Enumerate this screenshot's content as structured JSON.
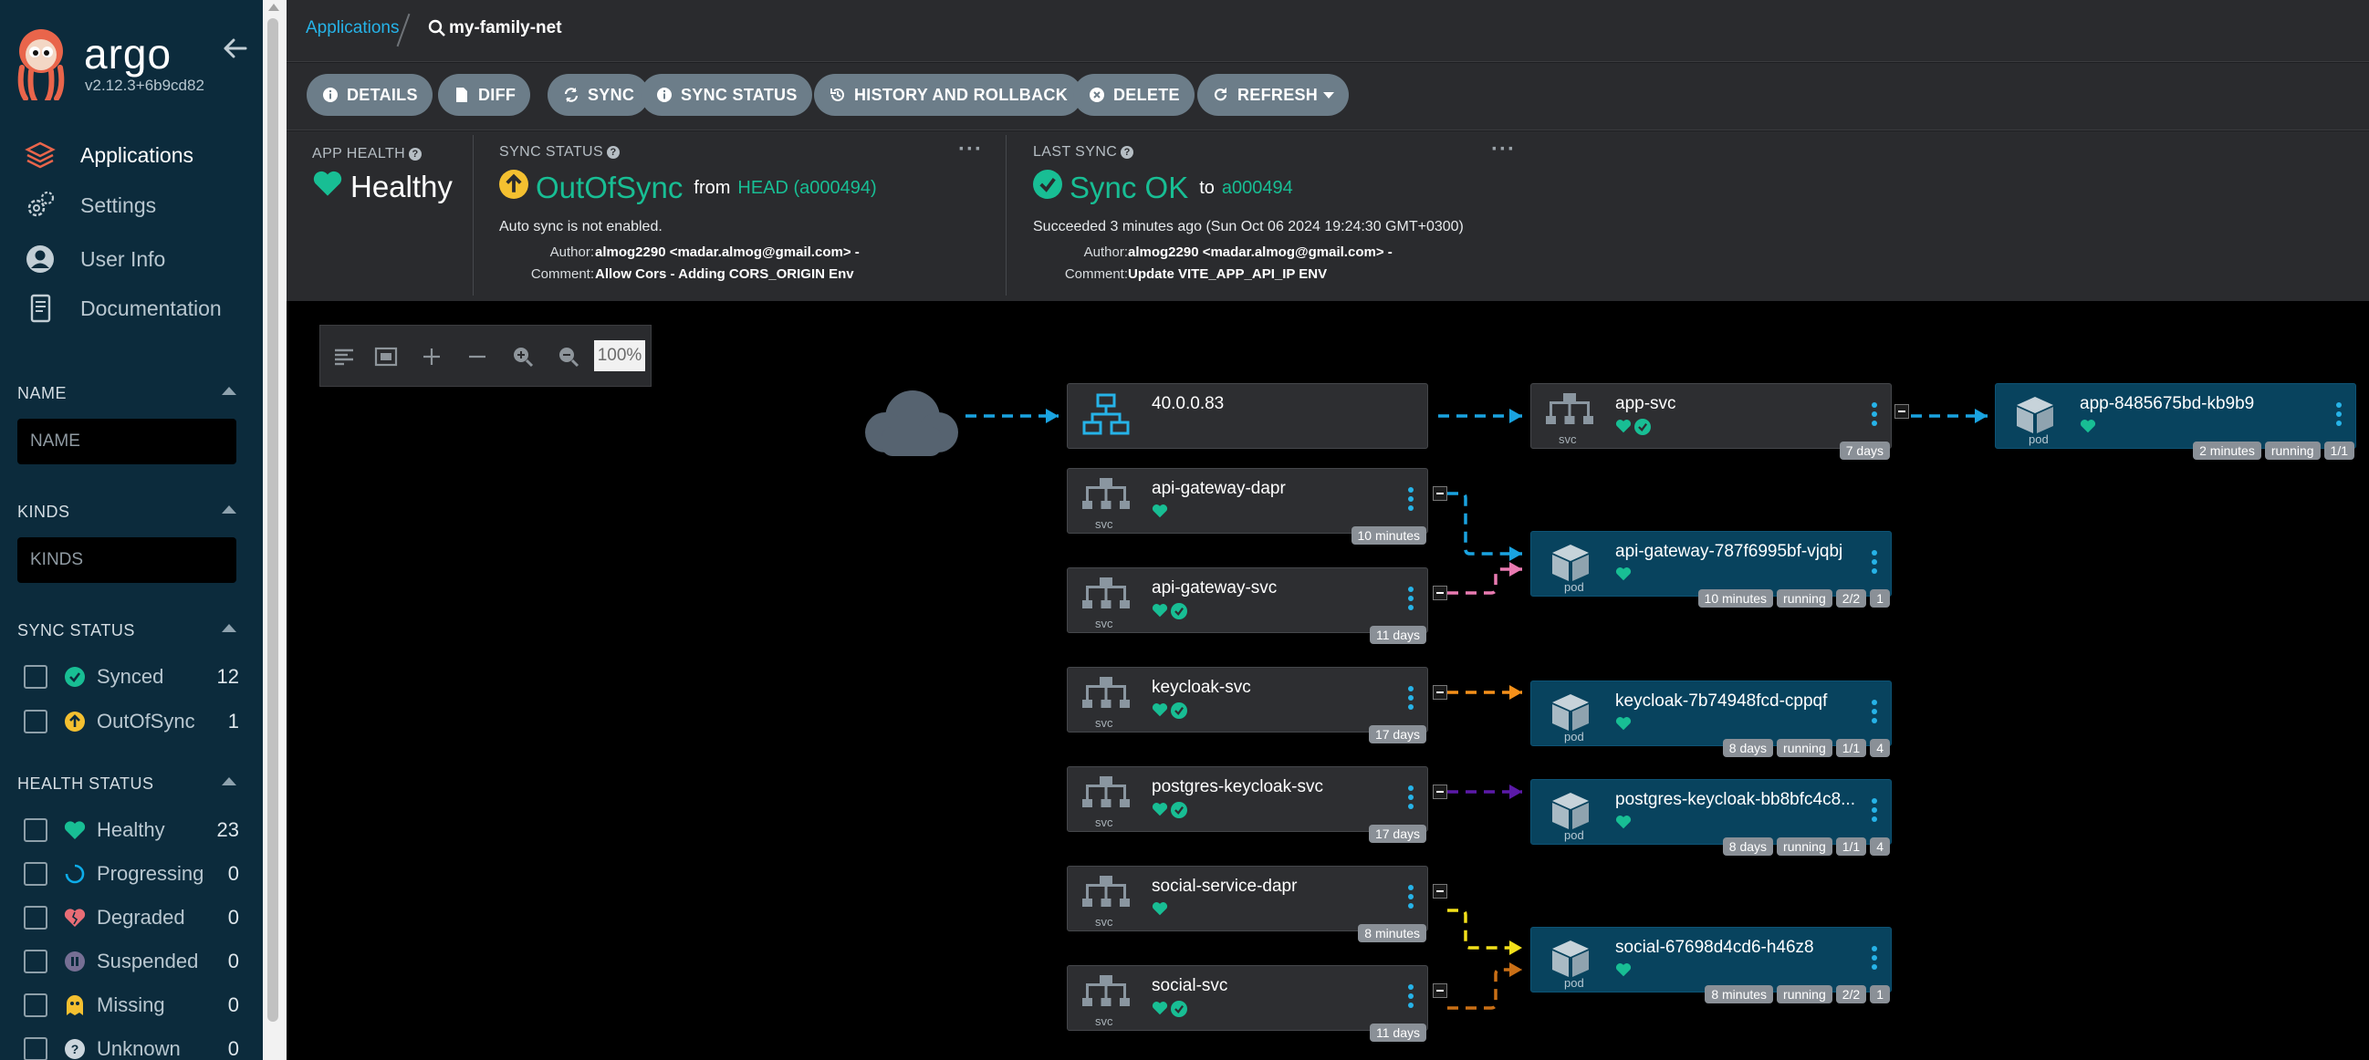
{
  "app": {
    "brand": "argo",
    "version": "v2.12.3+6b9cd82"
  },
  "nav": [
    {
      "label": "Applications",
      "icon": "layers-icon",
      "active": true
    },
    {
      "label": "Settings",
      "icon": "gears-icon",
      "active": false
    },
    {
      "label": "User Info",
      "icon": "user-circle-icon",
      "active": false
    },
    {
      "label": "Documentation",
      "icon": "book-icon",
      "active": false
    }
  ],
  "filters": {
    "name": {
      "label": "NAME",
      "placeholder": "NAME"
    },
    "kinds": {
      "label": "KINDS",
      "placeholder": "KINDS"
    },
    "sync_status": {
      "label": "SYNC STATUS",
      "items": [
        {
          "label": "Synced",
          "count": "12",
          "color": "#18be94"
        },
        {
          "label": "OutOfSync",
          "count": "1",
          "color": "#f4c030"
        }
      ]
    },
    "health_status": {
      "label": "HEALTH STATUS",
      "items": [
        {
          "label": "Healthy",
          "count": "23",
          "color": "#18be94"
        },
        {
          "label": "Progressing",
          "count": "0",
          "color": "#0dadea"
        },
        {
          "label": "Degraded",
          "count": "0",
          "color": "#e96d76"
        },
        {
          "label": "Suspended",
          "count": "0",
          "color": "#766f94"
        },
        {
          "label": "Missing",
          "count": "0",
          "color": "#f4c030"
        },
        {
          "label": "Unknown",
          "count": "0",
          "color": "#ccd6dd"
        }
      ]
    }
  },
  "breadcrumb": {
    "root": "Applications",
    "current": "my-family-net"
  },
  "toolbar": [
    {
      "label": "DETAILS",
      "icon": "info-icon"
    },
    {
      "label": "DIFF",
      "icon": "file-icon"
    },
    {
      "label": "SYNC",
      "icon": "sync-icon"
    },
    {
      "label": "SYNC STATUS",
      "icon": "info-icon"
    },
    {
      "label": "HISTORY AND ROLLBACK",
      "icon": "history-icon"
    },
    {
      "label": "DELETE",
      "icon": "times-circle-icon"
    },
    {
      "label": "REFRESH",
      "icon": "redo-icon"
    }
  ],
  "status": {
    "app_health": {
      "label": "APP HEALTH",
      "value": "Healthy"
    },
    "sync_status": {
      "label": "SYNC STATUS",
      "value": "OutOfSync",
      "from_label": "from",
      "revision": "HEAD (a000494)",
      "auto_sync": "Auto sync is not enabled.",
      "author_label": "Author:",
      "author": "almog2290 <madar.almog@gmail.com> -",
      "comment_label": "Comment:",
      "comment": "Allow Cors - Adding CORS_ORIGIN Env"
    },
    "last_sync": {
      "label": "LAST SYNC",
      "value": "Sync OK",
      "to_label": "to",
      "revision": "a000494",
      "succeeded": "Succeeded 3 minutes ago (Sun Oct 06 2024 19:24:30 GMT+0300)",
      "author_label": "Author:",
      "author": "almog2290 <madar.almog@gmail.com> -",
      "comment_label": "Comment:",
      "comment": "Update VITE_APP_API_IP ENV"
    }
  },
  "zoom": {
    "value": "100%"
  },
  "graph": {
    "ingress": {
      "name": "40.0.0.83"
    },
    "services": [
      {
        "name": "app-svc",
        "type": "svc",
        "age": "7 days",
        "synced": true
      },
      {
        "name": "api-gateway-dapr",
        "type": "svc",
        "age": "10 minutes",
        "synced": false
      },
      {
        "name": "api-gateway-svc",
        "type": "svc",
        "age": "11 days",
        "synced": true
      },
      {
        "name": "keycloak-svc",
        "type": "svc",
        "age": "17 days",
        "synced": true
      },
      {
        "name": "postgres-keycloak-svc",
        "type": "svc",
        "age": "17 days",
        "synced": true
      },
      {
        "name": "social-service-dapr",
        "type": "svc",
        "age": "8 minutes",
        "synced": false
      },
      {
        "name": "social-svc",
        "type": "svc",
        "age": "11 days",
        "synced": true
      }
    ],
    "pods": [
      {
        "name": "app-8485675bd-kb9b9",
        "type": "pod",
        "tags": [
          "2 minutes",
          "running",
          "1/1"
        ]
      },
      {
        "name": "api-gateway-787f6995bf-vjqbj",
        "type": "pod",
        "tags": [
          "10 minutes",
          "running",
          "2/2",
          "1"
        ]
      },
      {
        "name": "keycloak-7b74948fcd-cppqf",
        "type": "pod",
        "tags": [
          "8 days",
          "running",
          "1/1",
          "4"
        ]
      },
      {
        "name": "postgres-keycloak-bb8bfc4c8...",
        "type": "pod",
        "tags": [
          "8 days",
          "running",
          "1/1",
          "4"
        ]
      },
      {
        "name": "social-67698d4cd6-h46z8",
        "type": "pod",
        "tags": [
          "8 minutes",
          "running",
          "2/2",
          "1"
        ]
      }
    ],
    "edge_colors": {
      "blue": "#1aa3e0",
      "pink": "#e97ab1",
      "orange": "#f5901a",
      "purple": "#5b1aa8",
      "yellow": "#f3e01a",
      "brown": "#c96f16"
    }
  }
}
